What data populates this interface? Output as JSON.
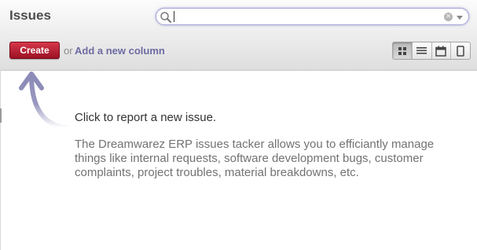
{
  "header": {
    "title": "Issues"
  },
  "search": {
    "value": "",
    "placeholder": "",
    "icon": "search-icon",
    "clear_icon_char": "×"
  },
  "toolbar": {
    "create_label": "Create",
    "or_label": "or",
    "add_column_label": "Add a new column"
  },
  "view_switcher": {
    "views": [
      {
        "icon": "kanban-view-icon",
        "active": true
      },
      {
        "icon": "list-view-icon",
        "active": false
      },
      {
        "icon": "calendar-view-icon",
        "active": false
      },
      {
        "icon": "form-view-icon",
        "active": false
      }
    ]
  },
  "help": {
    "title": "Click to report a new issue.",
    "body": "The Dreamwarez ERP issues tacker allows you to efficiantly manage things like internal requests, software development bugs, customer complaints, project troubles, material breakdowns, etc."
  },
  "colors": {
    "accent": "#6d6ba2",
    "primary_button": "#b8172c",
    "arrow": "#8d8cb8"
  }
}
